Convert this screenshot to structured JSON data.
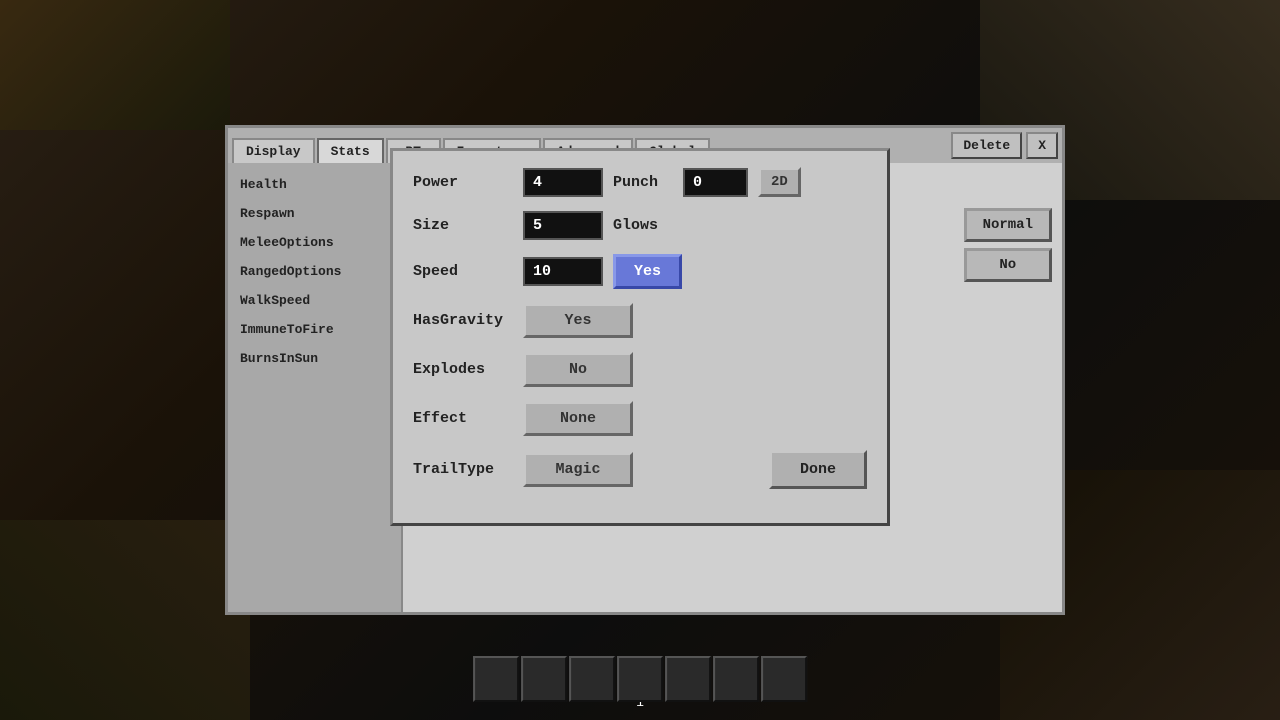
{
  "background": {
    "color": "#1a1208"
  },
  "tabs": {
    "items": [
      {
        "label": "Display",
        "active": false
      },
      {
        "label": "Stats",
        "active": true
      },
      {
        "label": "BT",
        "active": false
      },
      {
        "label": "Inventory",
        "active": false
      },
      {
        "label": "Advanced",
        "active": false
      },
      {
        "label": "Global",
        "active": false
      }
    ],
    "delete_label": "Delete",
    "close_label": "X"
  },
  "sidebar": {
    "items": [
      {
        "label": "Health"
      },
      {
        "label": "Respawn"
      },
      {
        "label": "MeleeOptions"
      },
      {
        "label": "RangedOptions"
      },
      {
        "label": "WalkSpeed"
      },
      {
        "label": "ImmuneToFire"
      },
      {
        "label": "BurnsInSun"
      }
    ]
  },
  "right_buttons": {
    "normal_label": "Normal",
    "no_label": "No"
  },
  "dialog": {
    "fields": {
      "power": {
        "label": "Power",
        "value": "4"
      },
      "punch": {
        "label": "Punch",
        "value": "0"
      },
      "mode_2d": {
        "label": "2D"
      },
      "size": {
        "label": "Size",
        "value": "5"
      },
      "glows": {
        "label": "Glows"
      },
      "glows_value": "Yes",
      "speed": {
        "label": "Speed",
        "value": "10"
      },
      "has_gravity": {
        "label": "HasGravity",
        "value": "Yes"
      },
      "explodes": {
        "label": "Explodes",
        "value": "No"
      },
      "effect": {
        "label": "Effect",
        "value": "None"
      },
      "trail_type": {
        "label": "TrailType",
        "value": "Magic"
      },
      "done": {
        "label": "Done"
      }
    }
  },
  "hotbar": {
    "number": "1",
    "slots": [
      {
        "selected": false
      },
      {
        "selected": false
      },
      {
        "selected": false
      },
      {
        "selected": false
      },
      {
        "selected": false
      },
      {
        "selected": false
      },
      {
        "selected": false
      }
    ]
  }
}
